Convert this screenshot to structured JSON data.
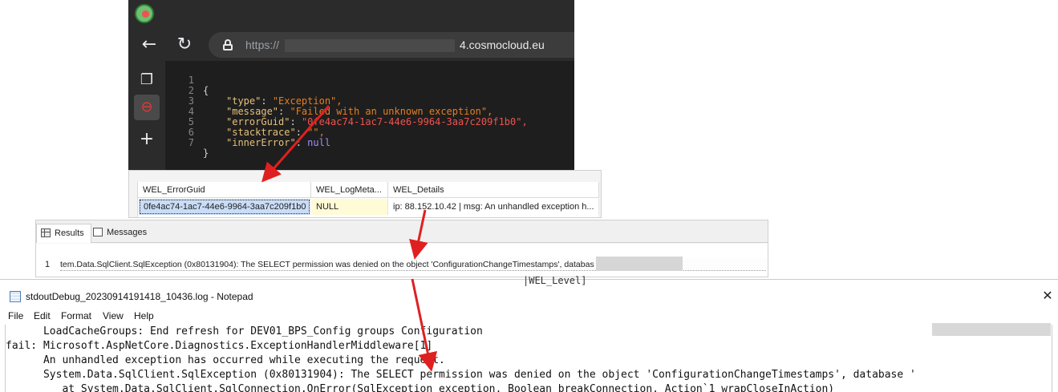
{
  "browser": {
    "url_scheme": "https://",
    "url_host": "4.cosmocloud.eu",
    "icons": [
      "back-arrow",
      "reload",
      "lock",
      "tabs",
      "extension",
      "plus"
    ]
  },
  "json_viewer": {
    "line_numbers": [
      "1",
      "2",
      "3",
      "4",
      "5",
      "6",
      "7"
    ],
    "open_brace": "{",
    "close_brace": "}",
    "fields": [
      {
        "key": "\"type\"",
        "value": "\"Exception\","
      },
      {
        "key": "\"message\"",
        "value": "\"Failed with an unknown exception\","
      },
      {
        "key": "\"errorGuid\"",
        "value": "\"0fe4ac74-1ac7-44e6-9964-3aa7c209f1b0\","
      },
      {
        "key": "\"stacktrace\"",
        "value": "\"\","
      },
      {
        "key": "\"innerError\"",
        "value": "null"
      }
    ]
  },
  "sql_grid": {
    "headers": [
      "WEL_ErrorGuid",
      "WEL_LogMeta...",
      "WEL_Details"
    ],
    "row": [
      "0fe4ac74-1ac7-44e6-9964-3aa7c209f1b0",
      "NULL",
      "ip: 88.152.10.42 | msg: An unhandled exception h..."
    ]
  },
  "ssms": {
    "tabs": [
      "Results",
      "Messages"
    ],
    "row_number": "1",
    "row_text": "tem.Data.SqlClient.SqlException (0x80131904): The SELECT permission was denied on the object 'ConfigurationChangeTimestamps', databas                             t', schema 'dbo'.      at"
  },
  "notepad": {
    "title": "stdoutDebug_20230914191418_10436.log - Notepad",
    "close_glyph": "✕",
    "menu": [
      "File",
      "Edit",
      "Format",
      "View",
      "Help"
    ],
    "lines": [
      "      LoadCacheGroups: End refresh for DEV01_BPS_Config groups Configuration",
      "fail: Microsoft.AspNetCore.Diagnostics.ExceptionHandlerMiddleware[1]",
      "      An unhandled exception has occurred while executing the request.",
      "      System.Data.SqlClient.SqlException (0x80131904): The SELECT permission was denied on the object 'ConfigurationChangeTimestamps', database '",
      "         at System.Data.SqlClient.SqlConnection.OnError(SqlException exception, Boolean breakConnection, Action`1 wrapCloseInAction)"
    ],
    "background_fragment": "|WEL_Level]"
  },
  "colors": {
    "browser_bg": "#202124",
    "json_key": "#e5c07b",
    "json_string": "#e67e22",
    "json_guid": "#ef5350",
    "json_null": "#a78bfa",
    "selection": "#c9ddf7",
    "null_cell": "#fffbd6",
    "arrow": "#e02020"
  }
}
